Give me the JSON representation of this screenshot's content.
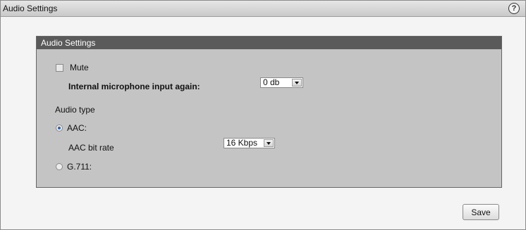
{
  "header": {
    "title": "Audio Settings",
    "help_icon": "?"
  },
  "panel": {
    "title": "Audio Settings",
    "mute": {
      "label": "Mute",
      "checked": false
    },
    "mic_gain": {
      "label": "Internal microphone input again:",
      "value": "0 db"
    },
    "audio_type": {
      "label": "Audio type"
    },
    "aac": {
      "label": "AAC:",
      "selected": true
    },
    "aac_bitrate": {
      "label": "AAC bit rate",
      "value": "16 Kbps"
    },
    "g711": {
      "label": "G.711:",
      "selected": false
    }
  },
  "footer": {
    "save_label": "Save"
  }
}
